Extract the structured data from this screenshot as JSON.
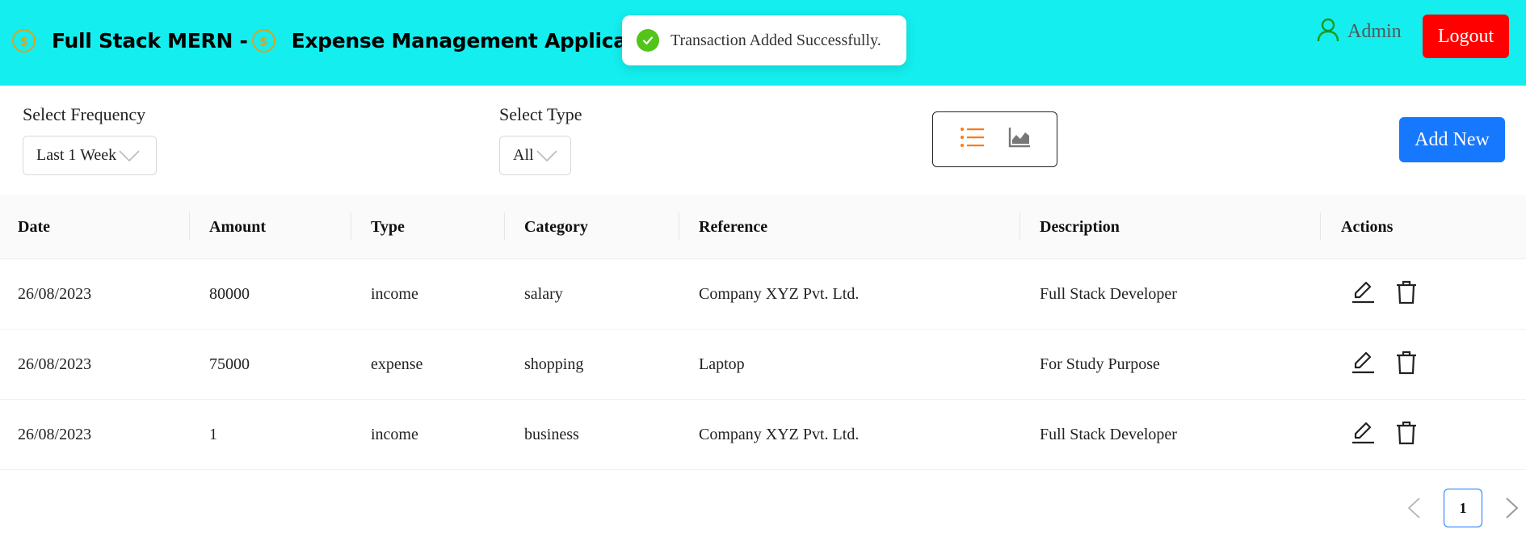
{
  "header": {
    "brand_part1": "Full Stack MERN -",
    "brand_part2": "Expense Management Application",
    "coin_symbol": "$",
    "user_name": "Admin",
    "logout_label": "Logout",
    "bg_color": "#14eeee"
  },
  "toast": {
    "message": "Transaction Added Successfully.",
    "status": "success",
    "color": "#52c41a"
  },
  "filters": {
    "frequency": {
      "label": "Select Frequency",
      "value": "Last 1 Week"
    },
    "type": {
      "label": "Select Type",
      "value": "All"
    },
    "view_toggle": {
      "active": "list-view",
      "options": [
        "list-view",
        "analytics-view"
      ],
      "active_color": "#fa7a17"
    },
    "add_new_label": "Add New"
  },
  "table": {
    "columns": [
      "Date",
      "Amount",
      "Type",
      "Category",
      "Reference",
      "Description",
      "Actions"
    ],
    "rows": [
      {
        "date": "26/08/2023",
        "amount": "80000",
        "type": "income",
        "category": "salary",
        "reference": "Company XYZ Pvt. Ltd.",
        "description": "Full Stack Developer"
      },
      {
        "date": "26/08/2023",
        "amount": "75000",
        "type": "expense",
        "category": "shopping",
        "reference": "Laptop",
        "description": "For Study Purpose"
      },
      {
        "date": "26/08/2023",
        "amount": "1",
        "type": "income",
        "category": "business",
        "reference": "Company XYZ Pvt. Ltd.",
        "description": "Full Stack Developer"
      }
    ]
  },
  "pagination": {
    "current_page": "1"
  }
}
